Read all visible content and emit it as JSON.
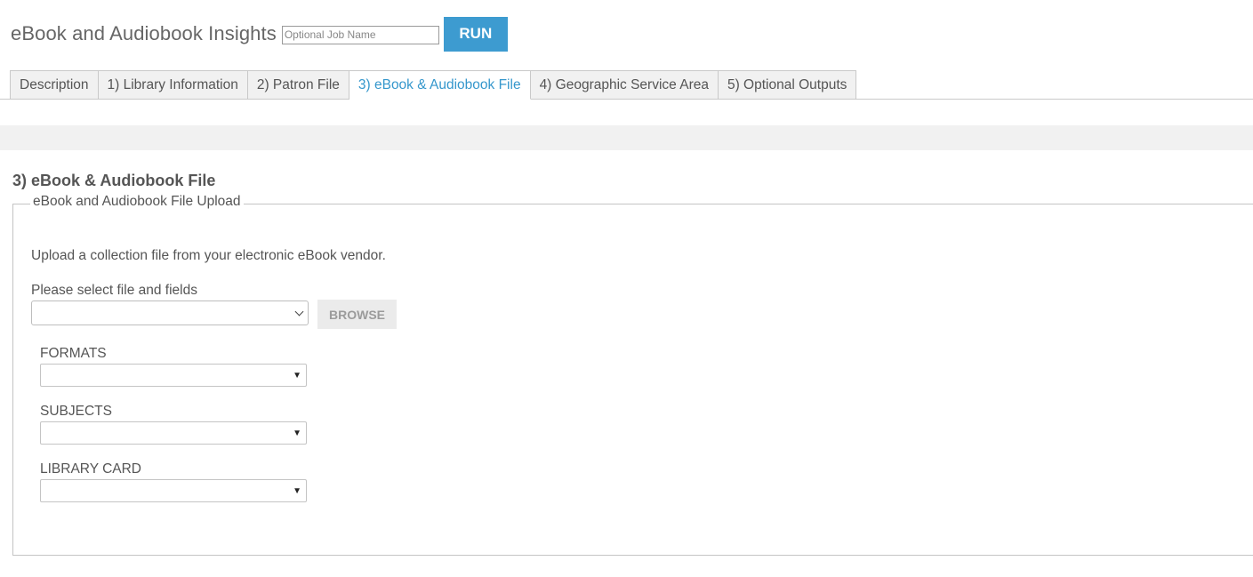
{
  "header": {
    "title": "eBook and Audiobook Insights",
    "job_name_value": "",
    "job_name_placeholder": "Optional Job Name",
    "run_label": "RUN"
  },
  "tabs": [
    {
      "label": "Description",
      "active": false
    },
    {
      "label": "1) Library Information",
      "active": false
    },
    {
      "label": "2) Patron File",
      "active": false
    },
    {
      "label": "3) eBook & Audiobook File",
      "active": true
    },
    {
      "label": "4) Geographic Service Area",
      "active": false
    },
    {
      "label": "5) Optional Outputs",
      "active": false
    }
  ],
  "section": {
    "title": "3) eBook & Audiobook File",
    "legend": "eBook and Audiobook File Upload",
    "description": "Upload a collection file from your electronic eBook vendor.",
    "file_select_label": "Please select file and fields",
    "file_select_value": "",
    "browse_label": "BROWSE",
    "fields": [
      {
        "label": "FORMATS",
        "value": ""
      },
      {
        "label": "SUBJECTS",
        "value": ""
      },
      {
        "label": "LIBRARY CARD",
        "value": ""
      }
    ]
  },
  "colors": {
    "accent": "#3d9bd0",
    "active_tab_text": "#3597cc",
    "tab_bg": "#f1f1f1",
    "band_bg": "#f1f1f1",
    "browse_bg": "#ebebeb"
  }
}
